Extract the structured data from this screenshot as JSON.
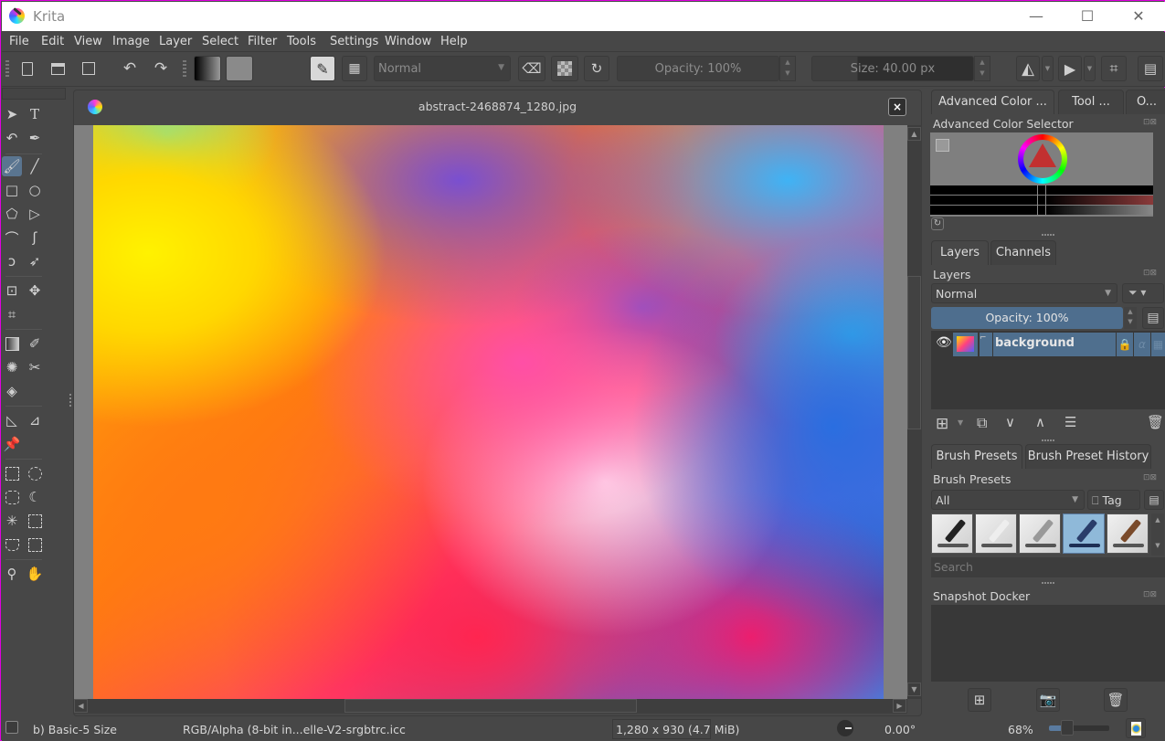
{
  "app": {
    "title": "Krita"
  },
  "window_controls": {
    "minimize": "—",
    "maximize": "☐",
    "close": "✕"
  },
  "menu": [
    "File",
    "Edit",
    "View",
    "Image",
    "Layer",
    "Select",
    "Filter",
    "Tools",
    "Settings",
    "Window",
    "Help"
  ],
  "toolbar": {
    "blend_mode": "Normal",
    "opacity": "Opacity: 100%",
    "size": "Size: 40.00 px"
  },
  "document": {
    "title": "abstract-2468874_1280.jpg"
  },
  "toolbox": {
    "tools": [
      "select-shapes",
      "text",
      "edit-shapes",
      "calligraphy",
      "freehand-brush",
      "line",
      "rectangle",
      "ellipse",
      "polygon",
      "polyline",
      "bezier-curve",
      "freehand-path",
      "dynamic-brush",
      "multibrush",
      "transform",
      "move",
      "crop",
      "gradient",
      "color-sampler",
      "colorize-mask",
      "smart-patch",
      "fill",
      "assistant",
      "measure",
      "reference-images",
      "rect-select",
      "ellipse-select",
      "polygon-select",
      "freehand-select",
      "contiguous-select",
      "similar-select",
      "bezier-select",
      "magnetic-select",
      "zoom",
      "pan"
    ]
  },
  "right_dock": {
    "top_tabs": [
      "Advanced Color ...",
      "Tool ...",
      "O..."
    ],
    "color_selector": {
      "title": "Advanced Color Selector"
    },
    "layer_tabs": [
      "Layers",
      "Channels"
    ],
    "layers": {
      "title": "Layers",
      "blend_mode": "Normal",
      "opacity": "Opacity:  100%",
      "items": [
        {
          "name": "background",
          "visible": true,
          "selected": true
        }
      ]
    },
    "brush_tabs": [
      "Brush Presets",
      "Brush Preset History"
    ],
    "brush_presets": {
      "title": "Brush Presets",
      "filter": "All",
      "tag_label": "Tag",
      "search_placeholder": "Search",
      "presets": [
        "basic-ink-pen",
        "basic-pencil",
        "basic-pencil-soft",
        "basic-5-size",
        "basic-paint-brush"
      ],
      "selected_index": 3
    },
    "snapshot": {
      "title": "Snapshot Docker"
    }
  },
  "status": {
    "brush": "b) Basic-5 Size",
    "color_profile": "RGB/Alpha (8-bit in...elle-V2-srgbtrc.icc",
    "image_size": "1,280 x 930 (4.7 MiB)",
    "rotation": "0.00°",
    "zoom": "68%",
    "zoom_fraction": 0.3
  },
  "colors": {
    "accent": "#5a7590",
    "selection": "#4f6f8e",
    "bg": "#474747"
  }
}
